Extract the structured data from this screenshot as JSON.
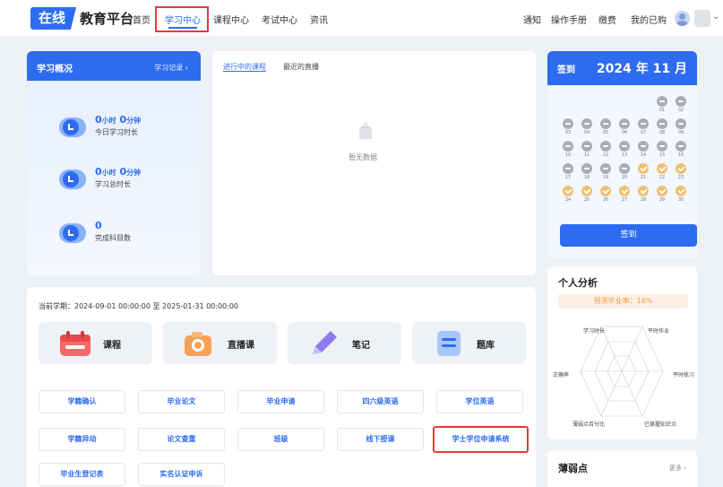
{
  "brand": {
    "badge": "在线",
    "name": "教育平台"
  },
  "nav": {
    "items": [
      "首页",
      "学习中心",
      "课程中心",
      "考试中心",
      "资讯"
    ],
    "right": [
      "通知",
      "操作手册",
      "缴费",
      "我的已购"
    ]
  },
  "overview": {
    "title": "学习概况",
    "link": "学习记录 ›",
    "today": {
      "h": "0",
      "hu": "小时",
      "m": "0",
      "mu": "分钟",
      "label": "今日学习时长"
    },
    "total": {
      "h": "0",
      "hu": "小时",
      "m": "0",
      "mu": "分钟",
      "label": "学习总时长"
    },
    "done": {
      "value": "0",
      "label": "完成科目数"
    }
  },
  "courses": {
    "tab_active": "进行中的课程",
    "tab_other": "最近的直播",
    "empty": "暂无数据"
  },
  "signin": {
    "title": "签到",
    "month": "2024 年 11 月",
    "button": "签到",
    "days": [
      "01",
      "02",
      "03",
      "04",
      "05",
      "06",
      "07",
      "08",
      "09",
      "10",
      "11",
      "12",
      "13",
      "14",
      "15",
      "16",
      "17",
      "18",
      "19",
      "20",
      "21",
      "22",
      "23",
      "24",
      "25",
      "26",
      "27",
      "28",
      "29",
      "30"
    ],
    "checked": [
      "21",
      "22",
      "23",
      "24",
      "25",
      "26",
      "27",
      "28",
      "29",
      "30"
    ]
  },
  "analysis": {
    "title": "个人分析",
    "predict": "预测毕业率：16%",
    "axes": [
      "学习时长",
      "平时作业",
      "平时练习",
      "已掌握知识点",
      "薄弱点百分比",
      "正确率"
    ]
  },
  "weak": {
    "title": "薄弱点",
    "more": "更多 ›"
  },
  "term": "当前学期：2024-09-01 00:00:00 至 2025-01-31 00:00:00",
  "features": [
    "课程",
    "直播课",
    "笔记",
    "题库"
  ],
  "buttons": [
    "学籍确认",
    "毕业论文",
    "毕业申请",
    "四六级英语",
    "学位英语",
    "学籍异动",
    "论文查重",
    "班级",
    "线下授课",
    "学士学位申请系统",
    "毕业生登记表",
    "实名认证申诉"
  ],
  "colors": {
    "primary": "#2d6cf0",
    "highlight": "#e43a3a",
    "checked": "#f0c070"
  }
}
